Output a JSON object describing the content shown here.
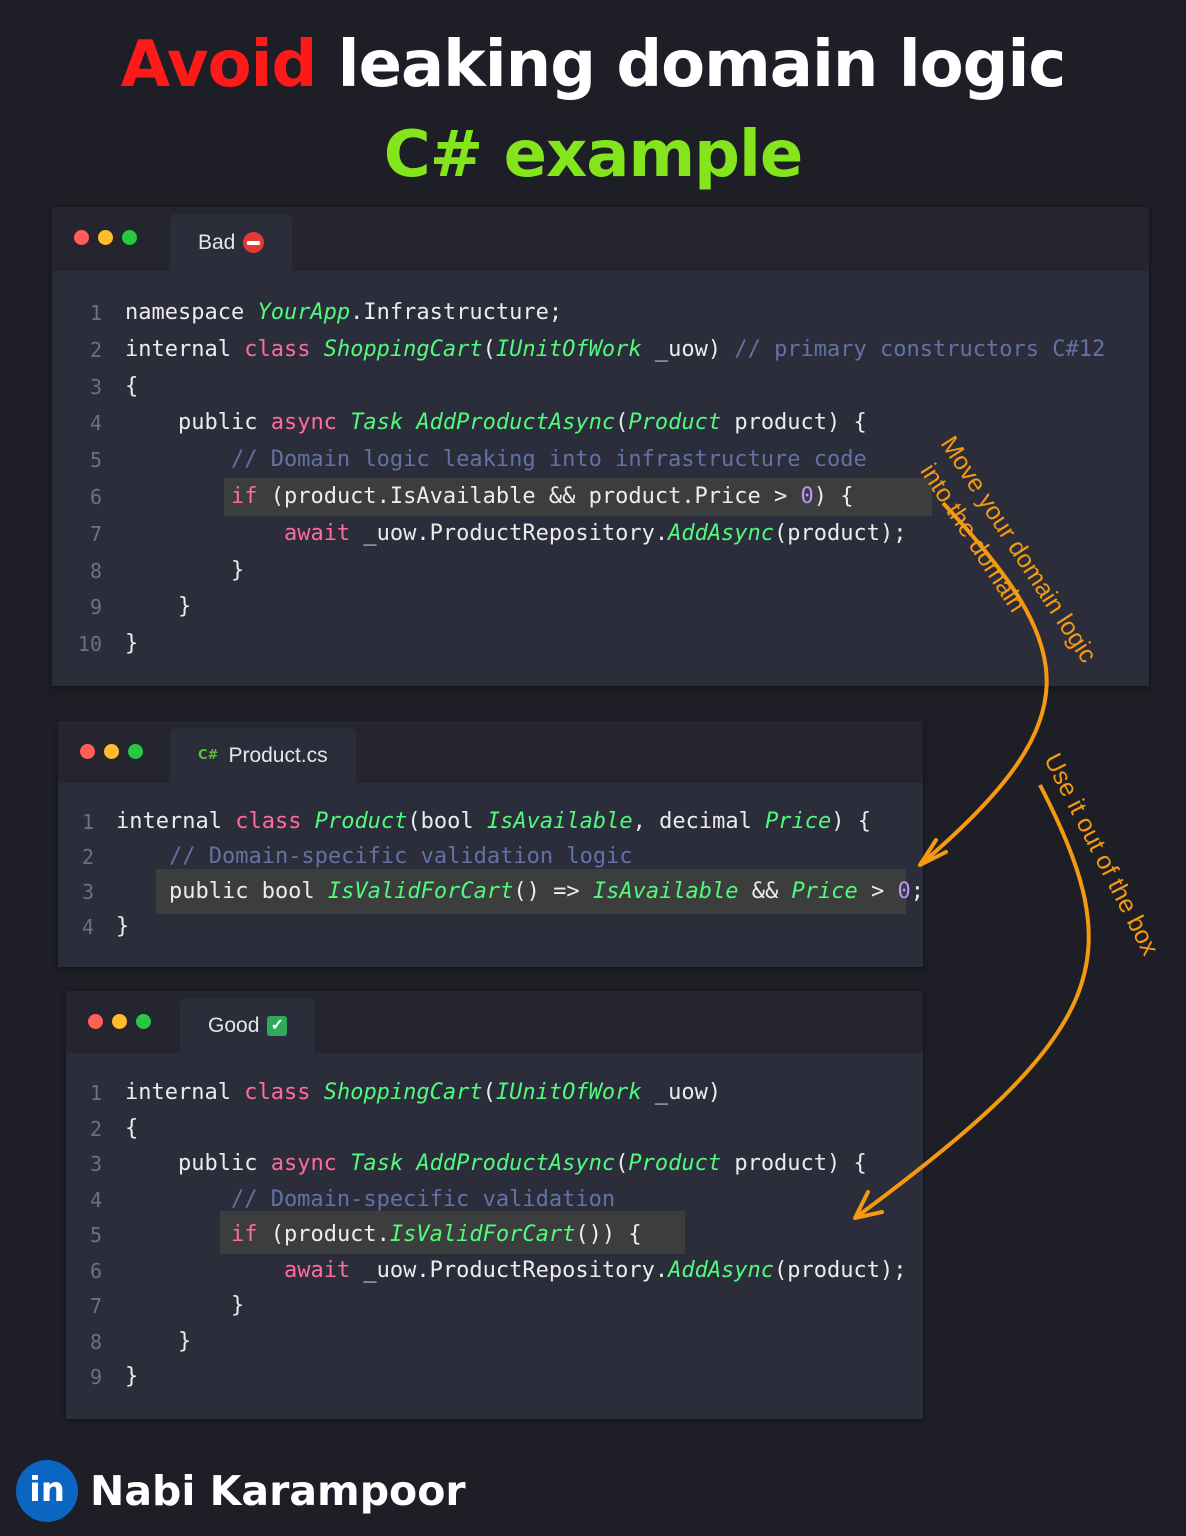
{
  "title": {
    "line1_red": "Avoid",
    "line1_rest": " leaking domain logic",
    "line2": "C# example"
  },
  "windows": {
    "bad": {
      "tab_label": "Bad",
      "lines": [
        [
          {
            "t": "namespace ",
            "c": ""
          },
          {
            "t": "YourApp",
            "c": "ty"
          },
          {
            "t": ".Infrastructure;",
            "c": ""
          }
        ],
        [
          {
            "t": "internal ",
            "c": ""
          },
          {
            "t": "class ",
            "c": "kw"
          },
          {
            "t": "ShoppingCart",
            "c": "ty"
          },
          {
            "t": "(",
            "c": ""
          },
          {
            "t": "IUnitOfWork",
            "c": "ty"
          },
          {
            "t": " _uow) ",
            "c": ""
          },
          {
            "t": "// primary constructors C#12",
            "c": "cm"
          }
        ],
        [
          {
            "t": "{",
            "c": ""
          }
        ],
        [
          {
            "t": "    public ",
            "c": ""
          },
          {
            "t": "async ",
            "c": "kw"
          },
          {
            "t": "Task ",
            "c": "ty"
          },
          {
            "t": "AddProductAsync",
            "c": "ty"
          },
          {
            "t": "(",
            "c": ""
          },
          {
            "t": "Product",
            "c": "ty"
          },
          {
            "t": " product) {",
            "c": ""
          }
        ],
        [
          {
            "t": "        // Domain logic leaking into infrastructure code",
            "c": "cm"
          }
        ],
        [
          {
            "t": "        ",
            "c": ""
          },
          {
            "t": "if",
            "c": "kw"
          },
          {
            "t": " (product.IsAvailable && product.Price > ",
            "c": ""
          },
          {
            "t": "0",
            "c": "nu"
          },
          {
            "t": ") {",
            "c": ""
          }
        ],
        [
          {
            "t": "            ",
            "c": ""
          },
          {
            "t": "await",
            "c": "kw"
          },
          {
            "t": " _uow.ProductRepository.",
            "c": ""
          },
          {
            "t": "AddAsync",
            "c": "ty"
          },
          {
            "t": "(product);",
            "c": ""
          }
        ],
        [
          {
            "t": "        }",
            "c": ""
          }
        ],
        [
          {
            "t": "    }",
            "c": ""
          }
        ],
        [
          {
            "t": "}",
            "c": ""
          }
        ]
      ]
    },
    "product": {
      "tab_icon": "C#",
      "tab_label": "Product.cs",
      "lines": [
        [
          {
            "t": "internal ",
            "c": ""
          },
          {
            "t": "class ",
            "c": "kw"
          },
          {
            "t": "Product",
            "c": "ty"
          },
          {
            "t": "(bool ",
            "c": ""
          },
          {
            "t": "IsAvailable",
            "c": "ty"
          },
          {
            "t": ", decimal ",
            "c": ""
          },
          {
            "t": "Price",
            "c": "ty"
          },
          {
            "t": ") {",
            "c": ""
          }
        ],
        [
          {
            "t": "    // Domain-specific validation logic",
            "c": "cm"
          }
        ],
        [
          {
            "t": "    public bool ",
            "c": ""
          },
          {
            "t": "IsValidForCart",
            "c": "ty"
          },
          {
            "t": "() => ",
            "c": ""
          },
          {
            "t": "IsAvailable",
            "c": "ty"
          },
          {
            "t": " && ",
            "c": ""
          },
          {
            "t": "Price",
            "c": "ty"
          },
          {
            "t": " > ",
            "c": ""
          },
          {
            "t": "0",
            "c": "nu"
          },
          {
            "t": ";",
            "c": ""
          }
        ],
        [
          {
            "t": "}",
            "c": ""
          }
        ]
      ]
    },
    "good": {
      "tab_label": "Good",
      "lines": [
        [
          {
            "t": "internal ",
            "c": ""
          },
          {
            "t": "class ",
            "c": "kw"
          },
          {
            "t": "ShoppingCart",
            "c": "ty"
          },
          {
            "t": "(",
            "c": ""
          },
          {
            "t": "IUnitOfWork",
            "c": "ty"
          },
          {
            "t": " _uow)",
            "c": ""
          }
        ],
        [
          {
            "t": "{",
            "c": ""
          }
        ],
        [
          {
            "t": "    public ",
            "c": ""
          },
          {
            "t": "async ",
            "c": "kw"
          },
          {
            "t": "Task ",
            "c": "ty"
          },
          {
            "t": "AddProductAsync",
            "c": "ty"
          },
          {
            "t": "(",
            "c": ""
          },
          {
            "t": "Product",
            "c": "ty"
          },
          {
            "t": " product) {",
            "c": ""
          }
        ],
        [
          {
            "t": "        // Domain-specific validation",
            "c": "cm"
          }
        ],
        [
          {
            "t": "        ",
            "c": ""
          },
          {
            "t": "if",
            "c": "kw"
          },
          {
            "t": " (product.",
            "c": ""
          },
          {
            "t": "IsValidForCart",
            "c": "ty"
          },
          {
            "t": "()) {",
            "c": ""
          }
        ],
        [
          {
            "t": "            ",
            "c": ""
          },
          {
            "t": "await",
            "c": "kw"
          },
          {
            "t": " _uow.ProductRepository.",
            "c": ""
          },
          {
            "t": "AddAsync",
            "c": "ty"
          },
          {
            "t": "(product);",
            "c": ""
          }
        ],
        [
          {
            "t": "        }",
            "c": ""
          }
        ],
        [
          {
            "t": "    }",
            "c": ""
          }
        ],
        [
          {
            "t": "}",
            "c": ""
          }
        ]
      ]
    }
  },
  "annotations": {
    "move_line1": "Move your domain logic",
    "move_line2": "into the domain",
    "use": "Use it out of the box"
  },
  "footer": {
    "badge": "in",
    "author": "Nabi Karampoor"
  },
  "colors": {
    "accent_arrow": "#f59a10",
    "title_red": "#ff1a1a",
    "title_green": "#84e51d"
  }
}
